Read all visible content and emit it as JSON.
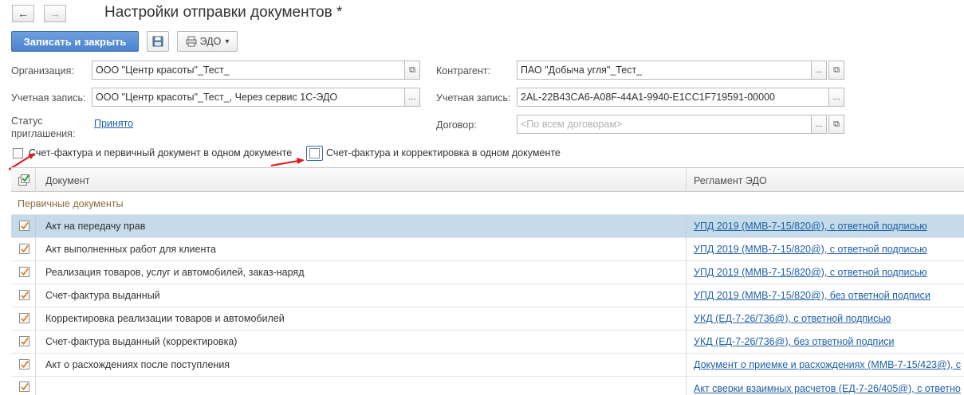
{
  "window": {
    "title": "Настройки отправки документов *"
  },
  "nav": {
    "back_icon": "←",
    "forward_icon": "→"
  },
  "toolbar": {
    "save_close_label": "Записать и закрыть",
    "edo_label": "ЭДО",
    "edo_arrow": "▾"
  },
  "form": {
    "org_label": "Организация:",
    "org_value": "ООО \"Центр красоты\"_Тест_",
    "account_label": "Учетная запись:",
    "account_value": "ООО \"Центр красоты\"_Тест_, Через сервис 1С-ЭДО",
    "status_label_1": "Статус",
    "status_label_2": "приглашения:",
    "status_value": "Принято",
    "counterparty_label": "Контрагент:",
    "counterparty_value": "ПАО \"Добыча угля\"_Тест_",
    "cp_account_label": "Учетная запись:",
    "cp_account_value": "2AL-22B43CA6-A08F-44A1-9940-E1CC1F719591-00000",
    "contract_label": "Договор:",
    "contract_placeholder": "<По всем договорам>",
    "dots": "...",
    "open_icon": "⧉"
  },
  "options": {
    "invoice_primary_label": "Счет-фактура и первичный документ в одном документе",
    "invoice_correction_label": "Счет-фактура и корректировка в одном документе"
  },
  "table": {
    "col_document": "Документ",
    "col_regulation": "Регламент ЭДО",
    "group_label": "Первичные документы",
    "rows": [
      {
        "doc": "Акт на передачу прав",
        "reg": "УПД 2019 (ММВ-7-15/820@), с ответной подписью"
      },
      {
        "doc": "Акт выполненных работ для клиента",
        "reg": "УПД 2019 (ММВ-7-15/820@), с ответной подписью"
      },
      {
        "doc": "Реализация товаров, услуг и автомобилей, заказ-наряд",
        "reg": "УПД 2019 (ММВ-7-15/820@), с ответной подписью"
      },
      {
        "doc": "Счет-фактура выданный",
        "reg": "УПД 2019 (ММВ-7-15/820@), без ответной подписи"
      },
      {
        "doc": "Корректировка реализации товаров и автомобилей",
        "reg": "УКД (ЕД-7-26/736@), с ответной подписью"
      },
      {
        "doc": "Счет-фактура выданный (корректировка)",
        "reg": "УКД (ЕД-7-26/736@), без ответной подписи"
      },
      {
        "doc": "Акт о расхождениях после поступления",
        "reg": "Документ о приемке и расхождениях (ММВ-7-15/423@), с"
      },
      {
        "doc": "",
        "reg": "Акт сверки взаимных расчетов (ЕД-7-26/405@), с ответно"
      }
    ]
  },
  "colors": {
    "accent": "#4b82cc",
    "link": "#1f5ea8",
    "selected_row": "#c5dbe9",
    "arrow": "#e0161b",
    "check": "#e07a1f"
  }
}
